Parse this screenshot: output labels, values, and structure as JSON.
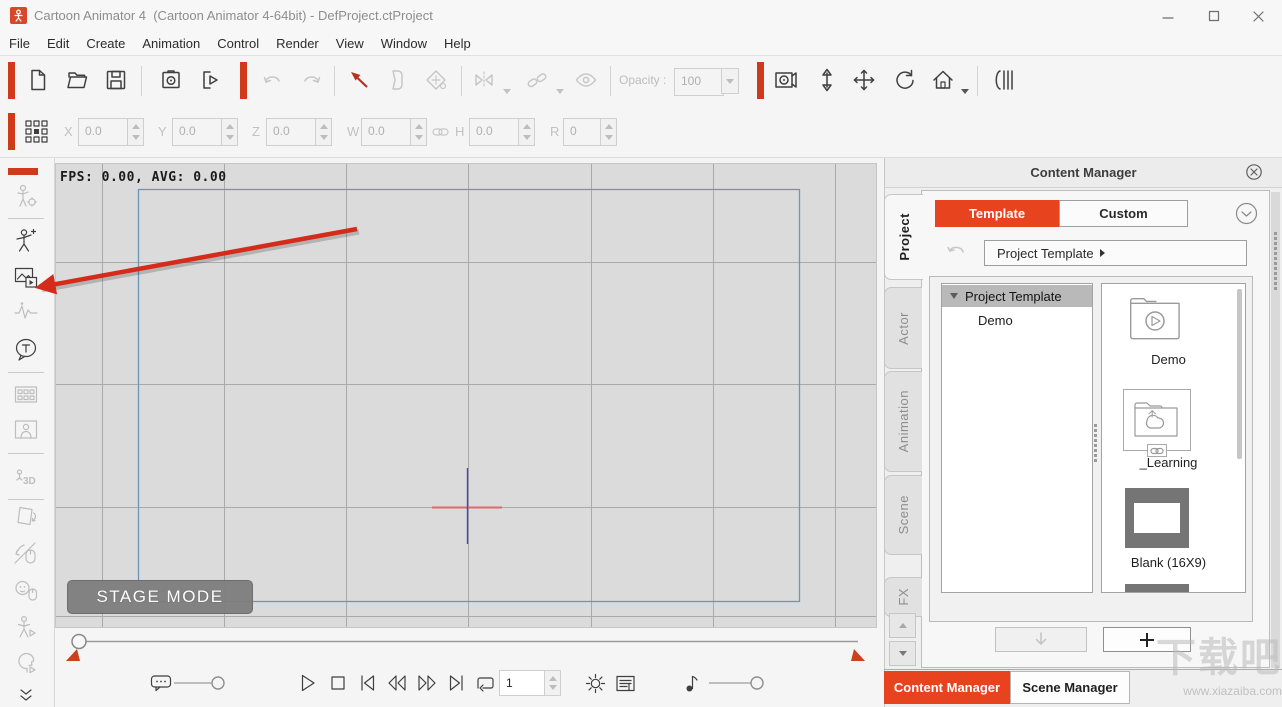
{
  "window": {
    "title": "Cartoon Animator 4  (Cartoon Animator 4-64bit) - DefProject.ctProject",
    "controls": [
      "minimize",
      "maximize",
      "close"
    ]
  },
  "menubar": {
    "items": [
      "File",
      "Edit",
      "Create",
      "Animation",
      "Control",
      "Render",
      "View",
      "Window",
      "Help"
    ]
  },
  "toolbar": {
    "opacity_label": "Opacity :",
    "opacity_value": "100",
    "icons_left": [
      "new-project",
      "open-project",
      "save-project",
      "render-preview",
      "export",
      "undo",
      "redo",
      "select-tool",
      "template-paper",
      "paint-bucket",
      "flip",
      "link",
      "visibility"
    ],
    "icons_right": [
      "camera-view",
      "zoom-tool",
      "move-tool",
      "rotate-tool",
      "home-view",
      "side-panel-curtain"
    ]
  },
  "transform_bar": {
    "grid_icon": "snap-grid",
    "fields": [
      {
        "label": "X",
        "value": "0.0"
      },
      {
        "label": "Y",
        "value": "0.0"
      },
      {
        "label": "Z",
        "value": "0.0"
      },
      {
        "label": "W",
        "value": "0.0"
      },
      {
        "label": "H",
        "value": "0.0"
      },
      {
        "label": "R",
        "value": "0"
      }
    ]
  },
  "sidebar": {
    "icons": [
      "actor-setup",
      "create-actor",
      "media-library",
      "audio",
      "text-bubble",
      "props",
      "scene-image",
      "3d-pose",
      "flip-page",
      "hand-mouse-puppet",
      "face-mouse-puppet",
      "body-puppet",
      "head-puppet",
      "more-tools-chevrons"
    ]
  },
  "canvas": {
    "fps_text": "FPS: 0.00, AVG: 0.00",
    "mode_badge": "STAGE MODE"
  },
  "playback": {
    "frame_value": "1",
    "icons": [
      "caption-bubble",
      "play",
      "stop",
      "go-to-start",
      "previous-frame",
      "next-frame",
      "go-to-end",
      "loop-range",
      "realtime-render",
      "render-options",
      "volume-note"
    ]
  },
  "content_manager": {
    "title": "Content Manager",
    "tabs": [
      {
        "label": "Template",
        "active": true
      },
      {
        "label": "Custom",
        "active": false
      }
    ],
    "side_tabs": [
      {
        "label": "Project",
        "active": true
      },
      {
        "label": "Actor",
        "active": false
      },
      {
        "label": "Animation",
        "active": false
      },
      {
        "label": "Scene",
        "active": false
      },
      {
        "label": "FX",
        "active": false
      }
    ],
    "breadcrumb": "Project Template",
    "tree": [
      {
        "label": "Project Template",
        "selected": true
      },
      {
        "label": "Demo",
        "selected": false
      }
    ],
    "items": [
      {
        "label": "Demo",
        "icon": "folder-play"
      },
      {
        "label": "_Learning",
        "icon": "folder-cloud-link"
      },
      {
        "label": "Blank (16X9)",
        "icon": "blank-stage"
      }
    ],
    "footer_tabs": [
      {
        "label": "Content Manager",
        "active": true
      },
      {
        "label": "Scene Manager",
        "active": false
      }
    ]
  },
  "watermark": {
    "line1": "下载吧",
    "line2": "www.xiazaiba.com"
  },
  "colors": {
    "accent": "#e8431f",
    "accent_bar": "#cf3a1b",
    "canvas_bg": "#dbdbdb",
    "grid_line": "#a9a9a9",
    "stage_outline": "#6d96ba",
    "crosshair_red": "#dd6b66",
    "crosshair_blue": "#4848c0",
    "annotation_arrow": "#d42b1a",
    "selected_row": "#b9b9b9"
  }
}
